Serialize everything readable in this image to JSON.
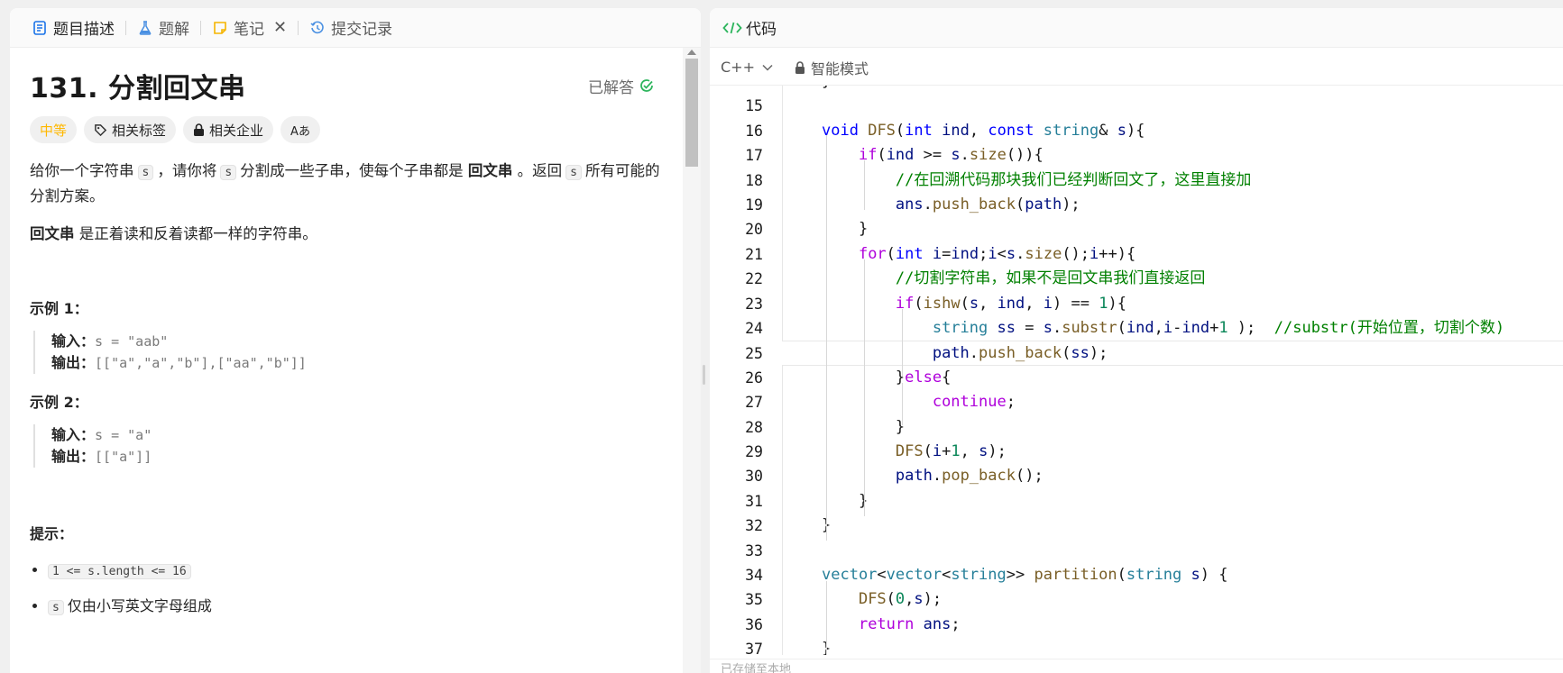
{
  "tabs": [
    {
      "label": "题目描述",
      "icon": "document-icon",
      "color": "#1a73e8"
    },
    {
      "label": "题解",
      "icon": "flask-icon",
      "color": "#4a90e2"
    },
    {
      "label": "笔记",
      "icon": "note-icon",
      "color": "#f5b400"
    },
    {
      "label": "提交记录",
      "icon": "history-icon",
      "color": "#4a90e2"
    }
  ],
  "problem": {
    "title": "131. 分割回文串",
    "status": "已解答",
    "tags": {
      "difficulty": "中等",
      "related_tags": "相关标签",
      "related_companies": "相关企业",
      "translate": "Aあ"
    },
    "desc": {
      "p1_a": "给你一个字符串",
      "p1_s1": "s",
      "p1_b": "，请你将",
      "p1_s2": "s",
      "p1_c": "分割成一些子串，使每个子串都是",
      "p1_bold": "回文串",
      "p1_d": "。返回",
      "p1_s3": "s",
      "p1_e": "所有可能的分割方案。",
      "p2_bold": "回文串",
      "p2_rest": "是正着读和反着读都一样的字符串。"
    },
    "examples": [
      {
        "title": "示例 1：",
        "input_label": "输入：",
        "input": "s = \"aab\"",
        "output_label": "输出：",
        "output": "[[\"a\",\"a\",\"b\"],[\"aa\",\"b\"]]"
      },
      {
        "title": "示例 2：",
        "input_label": "输入：",
        "input": "s = \"a\"",
        "output_label": "输出：",
        "output": "[[\"a\"]]"
      }
    ],
    "hints_title": "提示：",
    "hints": {
      "h1_code": "1 <= s.length <= 16",
      "h2_code": "s",
      "h2_text": "仅由小写英文字母组成"
    }
  },
  "editor": {
    "header": "代码",
    "language": "C++",
    "mode": "智能模式",
    "current_line": 25,
    "footer": "已存储至本地"
  }
}
